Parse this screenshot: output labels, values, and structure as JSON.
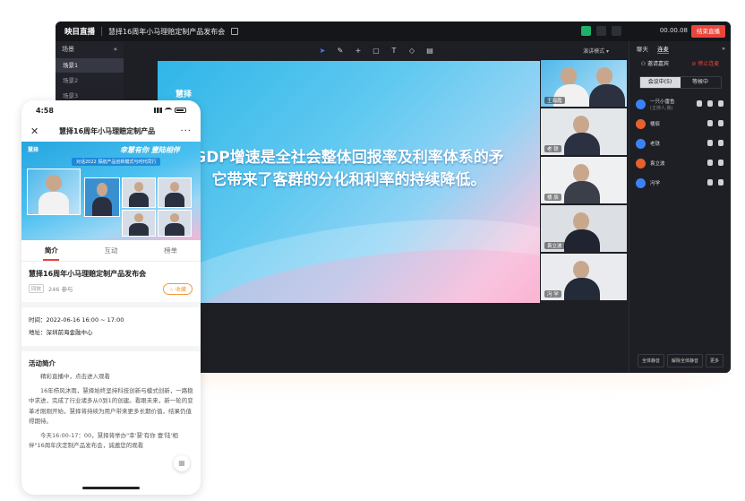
{
  "desktop": {
    "brand": "映目直播",
    "window_title": "慧择16周年小马理赔定制产品发布会",
    "timer": "00.00.08",
    "end_label": "结束直播",
    "sidebar": {
      "heading": "场景",
      "scenes": [
        "场景1",
        "场景2",
        "场景3"
      ]
    },
    "toolbar": {
      "tools": [
        "pointer-icon",
        "pen-icon",
        "crosshair-icon",
        "rectangle-icon",
        "text-icon",
        "eraser-icon",
        "trash-icon"
      ],
      "mode_label": "演讲模式"
    },
    "slide": {
      "logo_text": "慧择",
      "line1": "GDP增速是全社会整体回报率及利率体系的矛",
      "line2": "它带来了客群的分化和利率的持续降低。"
    },
    "tiles": [
      {
        "name": "王海霞"
      },
      {
        "name": "老 铁"
      },
      {
        "name": "楼 辰"
      },
      {
        "name": "袁立波"
      },
      {
        "name": "冯 学"
      }
    ],
    "right_panel": {
      "tabs": [
        "聊天",
        "连麦"
      ],
      "invite_label": "邀请嘉宾",
      "stop_label": "停止连麦",
      "segments": [
        "会议中(5)",
        "等候中"
      ],
      "participants": [
        {
          "name": "一只小雷鱼",
          "role": "(主持人,我)",
          "color": "#3b82f6"
        },
        {
          "name": "楼辰",
          "color": "#e8612c"
        },
        {
          "name": "老铁",
          "color": "#3b82f6"
        },
        {
          "name": "袁立波",
          "color": "#e8612c"
        },
        {
          "name": "冯学",
          "color": "#3b82f6"
        }
      ],
      "footer": [
        "全体静音",
        "解除全体静音",
        "更多"
      ]
    }
  },
  "phone": {
    "time": "4:58",
    "title": "慧择16周年小马理赔定制产品",
    "video": {
      "logo": "慧择",
      "headline": "幸慧有你 壹陆相伴",
      "subline": "对话2022 探航产品创新模式与时代同行"
    },
    "tabs": [
      "简介",
      "互动",
      "榜单"
    ],
    "event_title": "慧择16周年小马理赔定制产品发布会",
    "status_badge": "回放",
    "participants": "246 参与",
    "fav_label": "收藏",
    "time_line": "时间：2022-06-16 16:00 ~ 17:00",
    "address_line": "地址：深圳前海金融中心",
    "section_title": "活动简介",
    "paragraphs": [
      "精彩直播中，点击进入观看",
      "16年栉风沐雨，慧择始终坚持科技创新与模式创新，一路稳中求进，完成了行业诸多从0到1的创建。看眼未来，新一轮的变革才刚刚开始，慧择将持续为用户带来更多长期价值，结果仍值得期待。",
      "今天16:00-17：00，慧择将举办\"幸'慧'有你 壹'陆'相伴\"16周年庆定制产品发布会，诚邀您的观看"
    ]
  }
}
